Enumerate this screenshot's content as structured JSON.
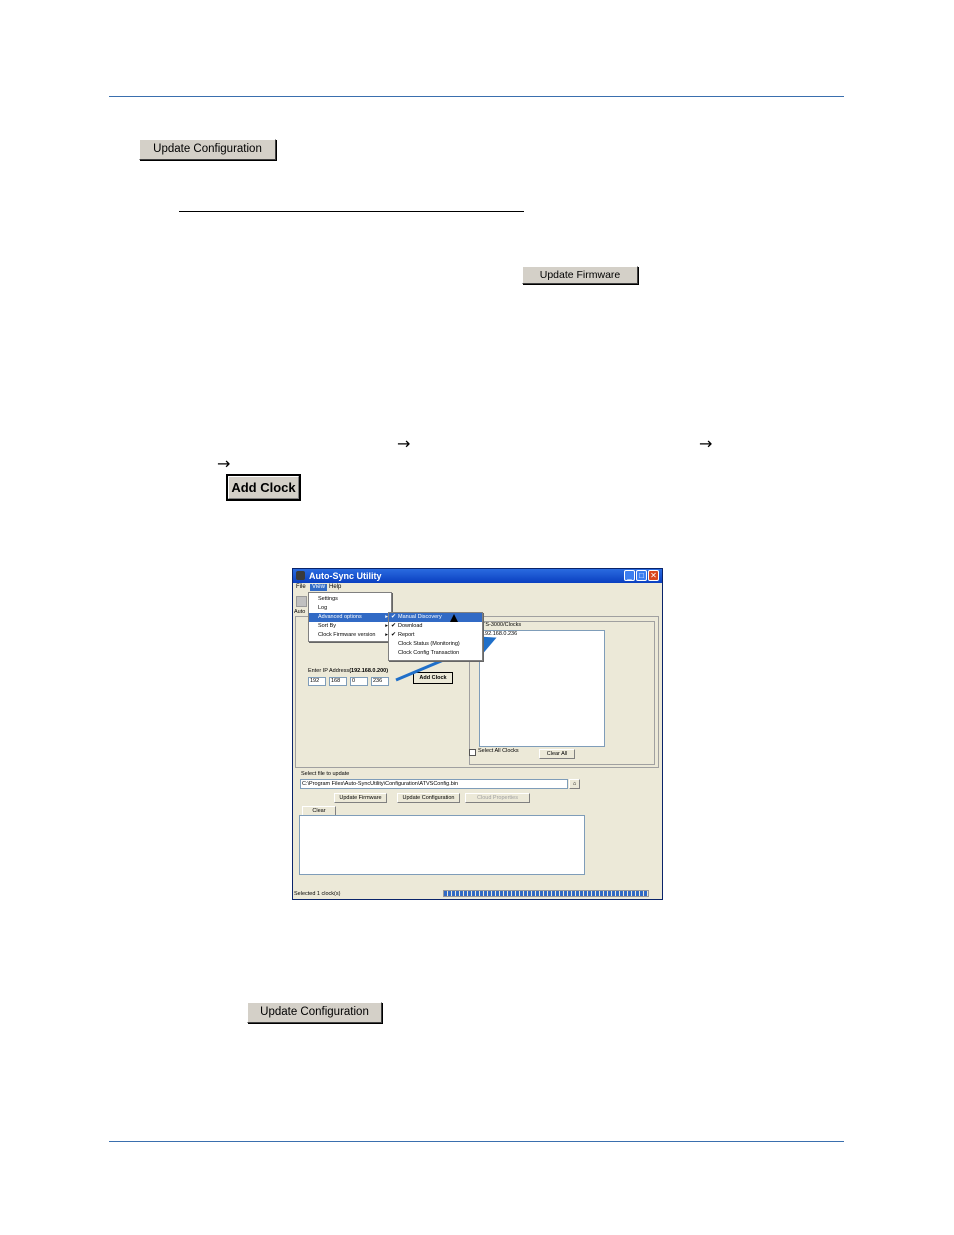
{
  "buttons": {
    "update_configuration_top": "Update Configuration",
    "update_firmware": "Update Firmware",
    "add_clock": "Add Clock",
    "update_configuration_bottom": "Update Configuration"
  },
  "arrows": {
    "symbol": "→"
  },
  "screenshot": {
    "title": "Auto-Sync Utility",
    "menubar": [
      "File",
      "View",
      "Help"
    ],
    "view_menu": [
      "Settings",
      "Log",
      "Advanced options",
      "Sort By",
      "Clock Firmware version"
    ],
    "advanced_submenu": [
      {
        "label": "Manual Discovery",
        "checked": true
      },
      {
        "label": "Download",
        "checked": true
      },
      {
        "label": "Report",
        "checked": true
      },
      {
        "label": "Clock Status (Monitoring)",
        "checked": false
      },
      {
        "label": "Clock Config Transaction",
        "checked": false
      }
    ],
    "toolbar_label": "Auto",
    "clocks_label": "TS-3000/Clocks",
    "clock_entries": [
      "192.168.0.236"
    ],
    "enter_ip_label": "Enter IP Address",
    "enter_ip_hint": "(192.168.0.200)",
    "ip_octets": [
      "192",
      "168",
      "0",
      "236"
    ],
    "add_clock_small": "Add Clock",
    "select_all_clocks": "Select All Clocks",
    "clear_all": "Clear All",
    "select_file_label": "Select file to update",
    "file_path": "C:\\Program Files\\Auto-SyncUtility\\Configuration\\ATVSConfig.bin",
    "btn_update_firmware": "Update Firmware",
    "btn_update_configuration": "Update Configuration",
    "btn_disabled": "Cloud Properties",
    "btn_clear": "Clear",
    "status_text": "Selected 1 clock(s)"
  }
}
